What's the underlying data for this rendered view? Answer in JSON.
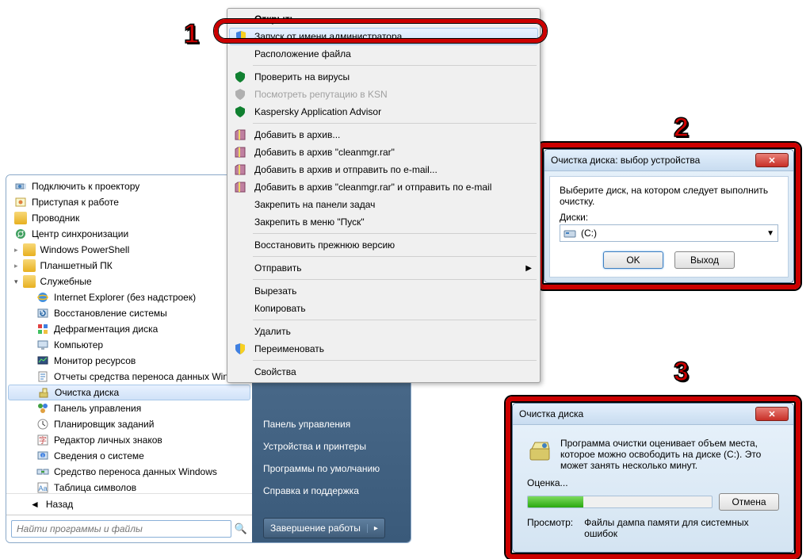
{
  "annotations": {
    "n1": "1",
    "n2": "2",
    "n3": "3"
  },
  "start_menu": {
    "items": [
      {
        "label": "Подключить к проектору",
        "icon": "projector"
      },
      {
        "label": "Приступая к работе",
        "icon": "getting-started"
      },
      {
        "label": "Проводник",
        "icon": "explorer"
      },
      {
        "label": "Центр синхронизации",
        "icon": "sync"
      },
      {
        "label": "Windows PowerShell",
        "icon": "folder"
      },
      {
        "label": "Планшетный ПК",
        "icon": "folder"
      },
      {
        "label": "Служебные",
        "icon": "folder",
        "expandable": true
      }
    ],
    "sub_items": [
      {
        "label": "Internet Explorer (без надстроек)",
        "icon": "ie"
      },
      {
        "label": "Восстановление системы",
        "icon": "restore"
      },
      {
        "label": "Дефрагментация диска",
        "icon": "defrag"
      },
      {
        "label": "Компьютер",
        "icon": "computer"
      },
      {
        "label": "Монитор ресурсов",
        "icon": "monitor"
      },
      {
        "label": "Отчеты средства переноса данных Wind",
        "icon": "reports"
      },
      {
        "label": "Очистка диска",
        "icon": "cleanup",
        "selected": true
      },
      {
        "label": "Панель управления",
        "icon": "control-panel"
      },
      {
        "label": "Планировщик заданий",
        "icon": "scheduler"
      },
      {
        "label": "Редактор личных знаков",
        "icon": "char-editor"
      },
      {
        "label": "Сведения о системе",
        "icon": "sysinfo"
      },
      {
        "label": "Средство переноса данных Windows",
        "icon": "transfer"
      },
      {
        "label": "Таблица символов",
        "icon": "charmap"
      }
    ],
    "back_label": "Назад",
    "search_placeholder": "Найти программы и файлы",
    "right_items": [
      "Панель управления",
      "Устройства и принтеры",
      "Программы по умолчанию",
      "Справка и поддержка"
    ],
    "shutdown_label": "Завершение работы"
  },
  "context_menu": {
    "groups": [
      [
        {
          "label": "Открыть",
          "bold": true
        },
        {
          "label": "Запуск от имени администратора",
          "icon": "shield",
          "highlighted": true
        },
        {
          "label": "Расположение файла"
        }
      ],
      [
        {
          "label": "Проверить на вирусы",
          "icon": "kav-green"
        },
        {
          "label": "Посмотреть репутацию в KSN",
          "icon": "kav-grey",
          "disabled": true
        },
        {
          "label": "Kaspersky Application Advisor",
          "icon": "kav-green"
        }
      ],
      [
        {
          "label": "Добавить в архив...",
          "icon": "winrar"
        },
        {
          "label": "Добавить в архив \"cleanmgr.rar\"",
          "icon": "winrar"
        },
        {
          "label": "Добавить в архив и отправить по e-mail...",
          "icon": "winrar"
        },
        {
          "label": "Добавить в архив \"cleanmgr.rar\" и отправить по e-mail",
          "icon": "winrar"
        },
        {
          "label": "Закрепить на панели задач"
        },
        {
          "label": "Закрепить в меню \"Пуск\""
        }
      ],
      [
        {
          "label": "Восстановить прежнюю версию"
        }
      ],
      [
        {
          "label": "Отправить",
          "submenu": true
        }
      ],
      [
        {
          "label": "Вырезать"
        },
        {
          "label": "Копировать"
        }
      ],
      [
        {
          "label": "Удалить"
        },
        {
          "label": "Переименовать",
          "icon": "shield"
        }
      ],
      [
        {
          "label": "Свойства"
        }
      ]
    ]
  },
  "dialog2": {
    "title": "Очистка диска: выбор устройства",
    "instruction": "Выберите диск, на котором следует выполнить очистку.",
    "drives_label": "Диски:",
    "selected_drive": "(C:)",
    "ok": "OK",
    "exit": "Выход"
  },
  "dialog3": {
    "title": "Очистка диска",
    "message": "Программа очистки оценивает объем места, которое можно освободить на диске  (C:). Это может занять несколько минут.",
    "progress_label": "Оценка...",
    "cancel": "Отмена",
    "scan_label": "Просмотр:",
    "scan_value": "Файлы дампа памяти для системных ошибок"
  }
}
